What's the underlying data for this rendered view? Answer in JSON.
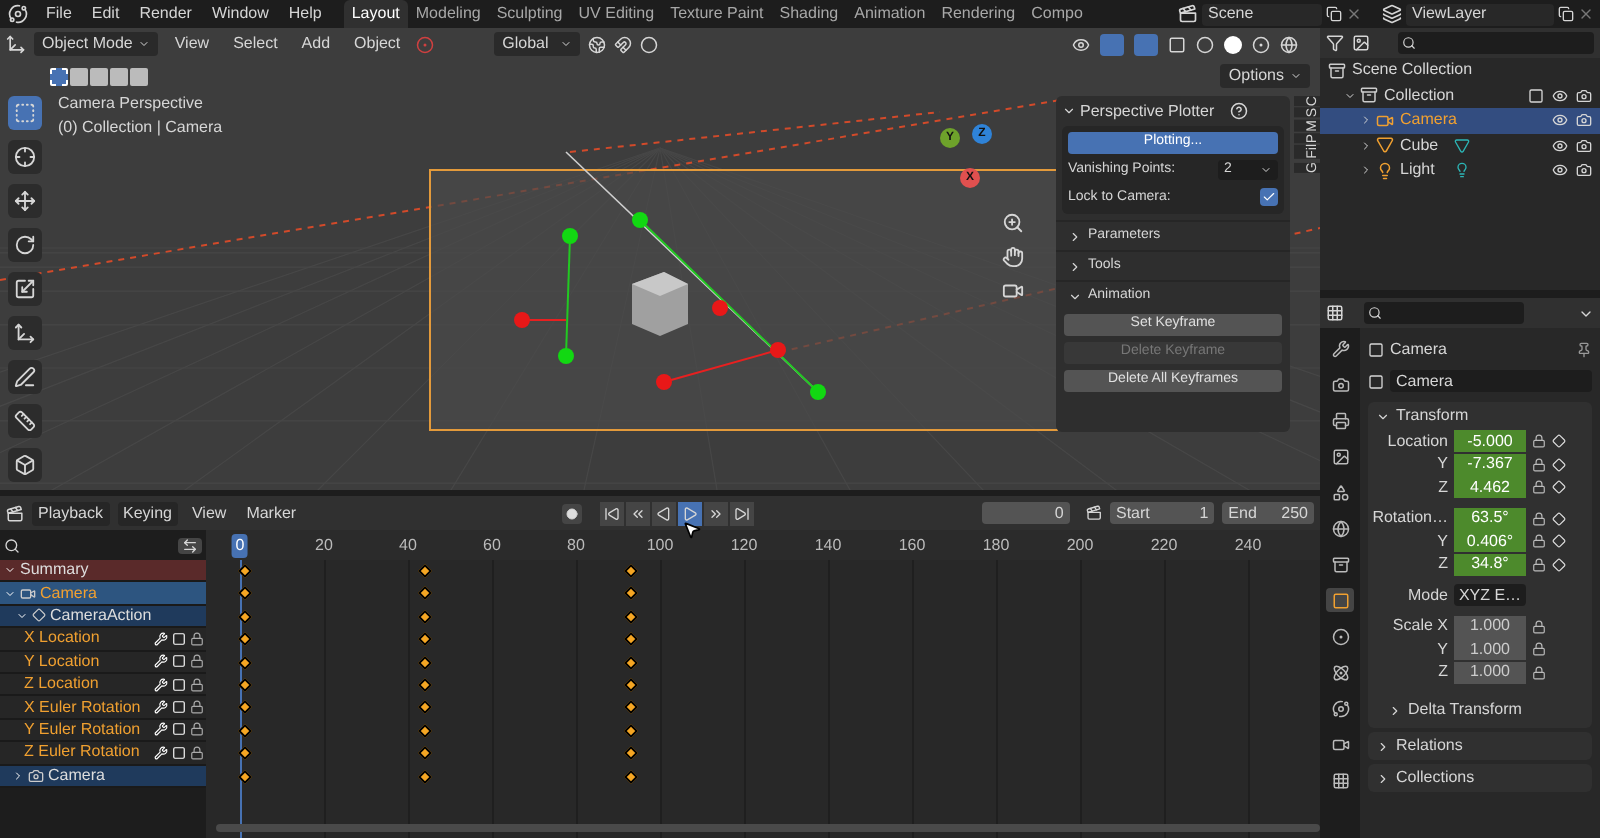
{
  "top_bar": {
    "menus": [
      "File",
      "Edit",
      "Render",
      "Window",
      "Help"
    ],
    "workspaces": [
      {
        "label": "Layout",
        "selected": true
      },
      {
        "label": "Modeling",
        "selected": false
      },
      {
        "label": "Sculpting",
        "selected": false
      },
      {
        "label": "UV Editing",
        "selected": false
      },
      {
        "label": "Texture Paint",
        "selected": false
      },
      {
        "label": "Shading",
        "selected": false
      },
      {
        "label": "Animation",
        "selected": false
      },
      {
        "label": "Rendering",
        "selected": false
      },
      {
        "label": "Compo",
        "selected": false
      }
    ],
    "scene": "Scene",
    "view_layer": "ViewLayer"
  },
  "viewport": {
    "mode": "Object Mode",
    "menus": [
      "View",
      "Select",
      "Add",
      "Object"
    ],
    "orientation": "Global",
    "options": "Options",
    "overlay_title": "Camera Perspective",
    "overlay_subtitle": "(0) Collection | Camera",
    "gizmo_axes": [
      "X",
      "Y",
      "Z"
    ],
    "sidebar_tabs": [
      "C",
      "S",
      "M",
      "P",
      "Fil",
      "G"
    ]
  },
  "plotter": {
    "title": "Perspective Plotter",
    "plot_button": "Plotting...",
    "vanishing_label": "Vanishing Points:",
    "vanishing_value": "2",
    "lock_label": "Lock to Camera:",
    "lock_checked": true,
    "sections": [
      {
        "label": "Parameters",
        "expanded": false
      },
      {
        "label": "Tools",
        "expanded": false
      },
      {
        "label": "Animation",
        "expanded": true
      }
    ],
    "buttons": [
      {
        "label": "Set Keyframe",
        "disabled": false
      },
      {
        "label": "Delete Keyframe",
        "disabled": true
      },
      {
        "label": "Delete All Keyframes",
        "disabled": false
      }
    ]
  },
  "outliner": {
    "items": [
      {
        "label": "Scene Collection",
        "kind": "scene",
        "selected": false,
        "children": [
          {
            "label": "Collection",
            "kind": "collection",
            "selected": false,
            "children": [
              {
                "label": "Camera",
                "kind": "camera",
                "selected": true
              },
              {
                "label": "Cube",
                "kind": "mesh",
                "selected": false
              },
              {
                "label": "Light",
                "kind": "light",
                "selected": false
              }
            ]
          }
        ]
      }
    ]
  },
  "properties": {
    "object_name": "Camera",
    "data_name": "Camera",
    "panel": "Transform",
    "groups": [
      {
        "rows": [
          {
            "label": "Location",
            "value": "-5.000",
            "kind": "animated"
          },
          {
            "label": "Y",
            "value": "-7.367",
            "kind": "animated"
          },
          {
            "label": "Z",
            "value": "4.462",
            "kind": "animated"
          }
        ]
      },
      {
        "rows": [
          {
            "label": "Rotation…",
            "value": "63.5°",
            "kind": "animated"
          },
          {
            "label": "Y",
            "value": "0.406°",
            "kind": "animated"
          },
          {
            "label": "Z",
            "value": "34.8°",
            "kind": "animated"
          }
        ]
      },
      {
        "rows": [
          {
            "label": "Mode",
            "value": "XYZ E…",
            "kind": "dropdown"
          }
        ]
      },
      {
        "rows": [
          {
            "label": "Scale X",
            "value": "1.000",
            "kind": "plain"
          },
          {
            "label": "Y",
            "value": "1.000",
            "kind": "plain"
          },
          {
            "label": "Z",
            "value": "1.000",
            "kind": "plain"
          }
        ]
      }
    ],
    "subsection": "Delta Transform",
    "panels": [
      "Relations",
      "Collections"
    ]
  },
  "timeline": {
    "menus": [
      "Playback",
      "Keying",
      "View",
      "Marker"
    ],
    "transport": [
      {
        "kind": "jump_start",
        "selected": false
      },
      {
        "kind": "prev_key",
        "selected": false
      },
      {
        "kind": "play_reverse",
        "selected": false
      },
      {
        "kind": "play",
        "selected": true
      },
      {
        "kind": "next_key",
        "selected": false
      },
      {
        "kind": "jump_end",
        "selected": false
      }
    ],
    "current_frame": "0",
    "start_label": "Start",
    "start": "1",
    "end_label": "End",
    "end": "250",
    "ruler": [
      "0",
      "20",
      "40",
      "60",
      "80",
      "100",
      "120",
      "140",
      "160",
      "180",
      "200",
      "220",
      "240"
    ],
    "channels": [
      {
        "label": "Summary",
        "kind": "summary"
      },
      {
        "label": "Camera",
        "kind": "object"
      },
      {
        "label": "CameraAction",
        "kind": "action"
      },
      {
        "label": "X Location",
        "kind": "fcurve"
      },
      {
        "label": "Y Location",
        "kind": "fcurve"
      },
      {
        "label": "Z Location",
        "kind": "fcurve"
      },
      {
        "label": "X Euler Rotation",
        "kind": "fcurve"
      },
      {
        "label": "Y Euler Rotation",
        "kind": "fcurve"
      },
      {
        "label": "Z Euler Rotation",
        "kind": "fcurve"
      },
      {
        "label": "Camera",
        "kind": "data"
      }
    ]
  }
}
